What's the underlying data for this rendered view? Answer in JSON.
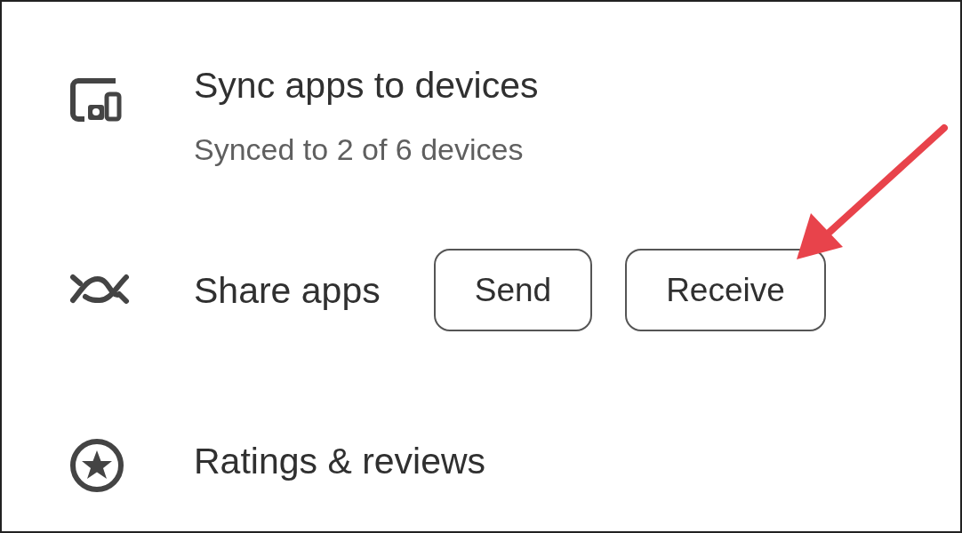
{
  "items": [
    {
      "kind": "subtitle",
      "title": "Sync apps to devices",
      "subtitle": "Synced to 2 of 6 devices"
    },
    {
      "kind": "actions",
      "title": "Share apps",
      "buttons": [
        "Send",
        "Receive"
      ]
    },
    {
      "kind": "plain",
      "title": "Ratings & reviews"
    }
  ]
}
